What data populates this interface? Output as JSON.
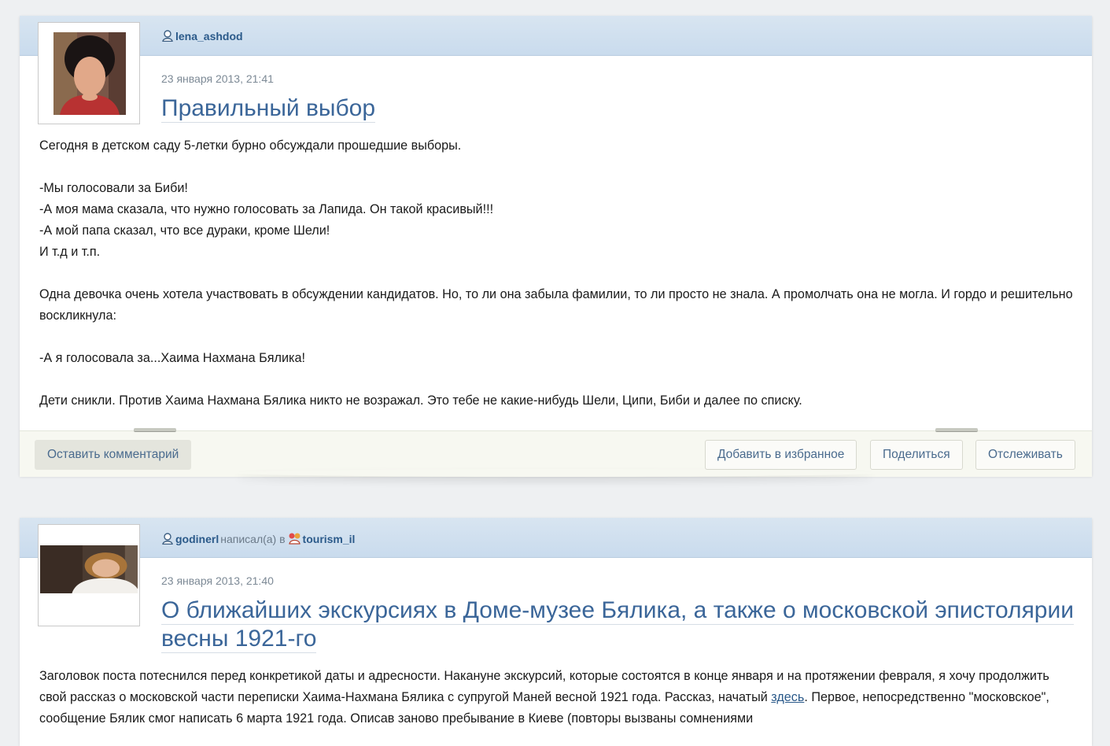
{
  "posts": [
    {
      "author": "lena_ashdod",
      "date": "23 января 2013, 21:41",
      "title": "Правильный выбор",
      "paragraphs": [
        [
          "Сегодня в детском саду  5-летки бурно обсуждали прошедшие выборы."
        ],
        [
          "-Мы голосовали за Биби!",
          "-А моя мама сказала, что нужно голосовать за Лапида. Он такой красивый!!!",
          "-А мой папа сказал, что все дураки, кроме Шели!",
          "И т.д  и т.п."
        ],
        [
          "Одна девочка очень хотела участвовать в обсуждении кандидатов. Но, то ли она забыла фамилии, то ли просто не знала. А промолчать она не могла. И гордо и решительно воскликнула:"
        ],
        [
          "-А я голосовала за...Хаима Нахмана Бялика!"
        ],
        [
          "Дети сникли. Против Хаима Нахмана Бялика никто не возражал. Это тебе не какие-нибудь Шели, Ципи, Биби и далее по списку."
        ]
      ],
      "actions": {
        "comment": "Оставить комментарий",
        "favorite": "Добавить в избранное",
        "share": "Поделиться",
        "track": "Отслеживать"
      }
    },
    {
      "author": "godinerl",
      "wrote_in": "написал(а) в",
      "community": "tourism_il",
      "date": "23 января 2013, 21:40",
      "title_line1": "О ближайших экскурсиях в Доме-музее Бялика, а также о московской эпистолярии",
      "title_line2": "весны 1921-го",
      "body_before_link": "Заголовок поста потеснился перед конкретикой даты и адресности. Накануне экскурсий, которые состоятся в конце января и на протяжении февраля, я хочу продолжить свой рассказ о московской части переписки Хаима-Нахмана Бялика с супругой Маней весной 1921 года. Рассказ, начатый ",
      "link_text": "здесь",
      "body_after_link": ". Первое, непосредственно \"московское\", сообщение Бялик смог написать 6 марта 1921 года. Описав заново пребывание в Киеве (повторы вызваны сомнениями"
    }
  ]
}
